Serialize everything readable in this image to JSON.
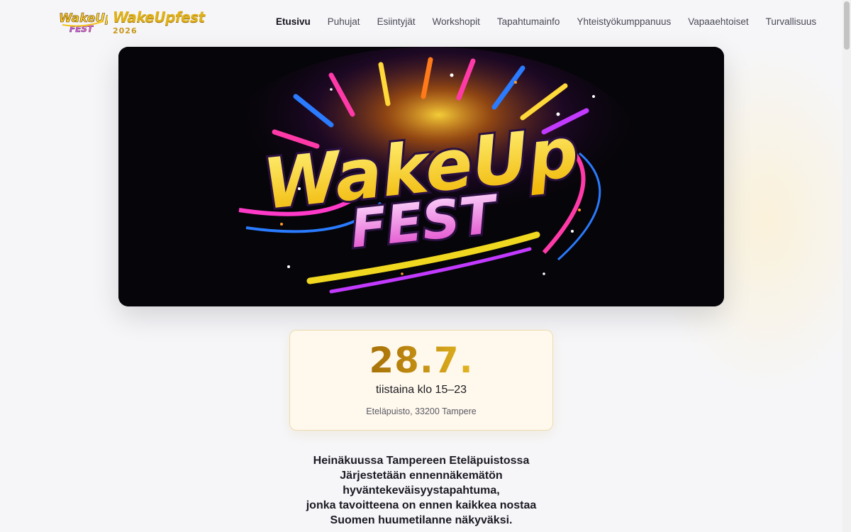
{
  "header": {
    "logo_badge_text_top": "WakeUp",
    "logo_badge_text_bottom": "FEST",
    "title": "WakeUpfest",
    "year": "2026"
  },
  "nav": {
    "items": [
      {
        "label": "Etusivu",
        "active": true
      },
      {
        "label": "Puhujat"
      },
      {
        "label": "Esiintyjät"
      },
      {
        "label": "Workshopit"
      },
      {
        "label": "Tapahtumainfo"
      },
      {
        "label": "Yhteistyökumppanuus"
      },
      {
        "label": "Vapaaehtoiset"
      },
      {
        "label": "Turvallisuus"
      }
    ]
  },
  "hero": {
    "text_top": "WakeUp",
    "text_bottom": "FEST"
  },
  "event": {
    "date": "28.7.",
    "time": "tiistaina klo 15–23",
    "location": "Eteläpuisto, 33200 Tampere"
  },
  "intro": {
    "lines": [
      "Heinäkuussa Tampereen Eteläpuistossa",
      "Järjestetään ennennäkemätön",
      "hyväntekeväisyystapahtuma,",
      "jonka tavoitteena on ennen kaikkea nostaa",
      "Suomen huumetilanne näkyväksi."
    ]
  },
  "colors": {
    "gold": "#e0b21a",
    "pink": "#e55bd6",
    "dark": "#060509"
  }
}
